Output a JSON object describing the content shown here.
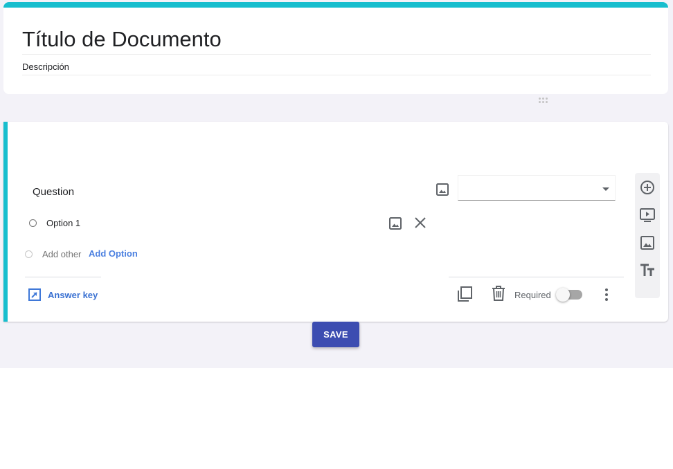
{
  "header": {
    "title": "Título de Documento",
    "description": "Descripción",
    "accent_color": "#17bece"
  },
  "question": {
    "label": "Question",
    "type_select": {
      "value": ""
    },
    "options": [
      {
        "label": "Option 1"
      }
    ],
    "add_other_label": "Add other",
    "add_option_label": "Add Option",
    "answer_key_label": "Answer key",
    "required_label": "Required",
    "required_on": false
  },
  "side_toolbar": {
    "tools": [
      "add-circle-icon",
      "video-icon",
      "image-icon",
      "text-title-icon"
    ]
  },
  "save_label": "SAVE",
  "colors": {
    "primary_button": "#3c4db1",
    "link": "#4a7fe0",
    "accent": "#17bece"
  }
}
